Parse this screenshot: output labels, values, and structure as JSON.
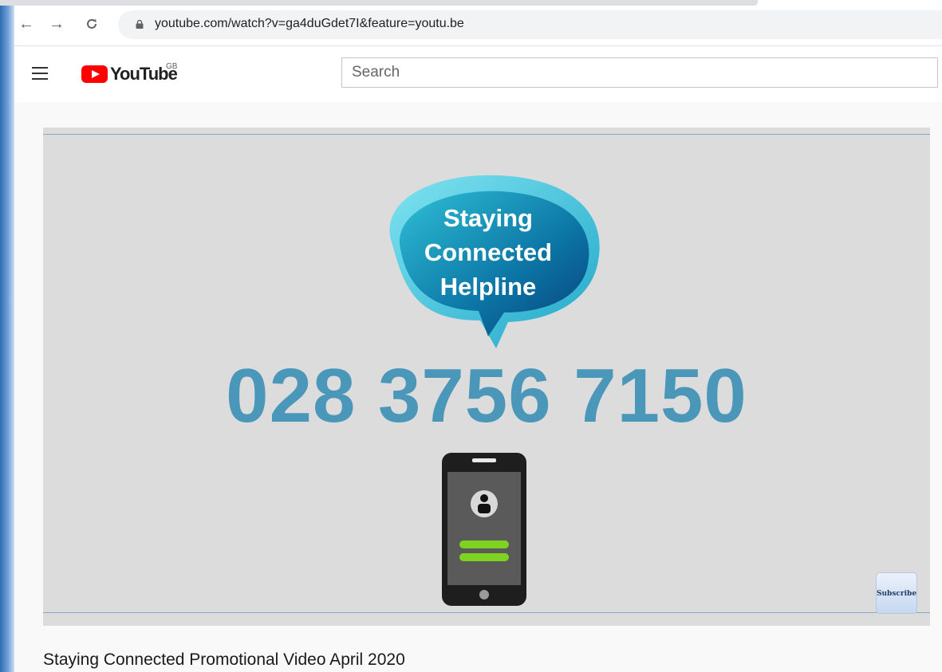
{
  "browser": {
    "url": "youtube.com/watch?v=ga4duGdet7I&feature=youtu.be",
    "back_icon": "arrow-left-icon",
    "forward_icon": "arrow-right-icon",
    "reload_icon": "reload-icon",
    "lock_icon": "lock-icon"
  },
  "youtube": {
    "menu_icon": "hamburger-menu-icon",
    "logo_text": "YouTube",
    "region": "GB",
    "search_placeholder": "Search"
  },
  "video": {
    "bubble_lines": [
      "Staying",
      "Connected",
      "Helpline"
    ],
    "phone_number": "028 3756 7150",
    "subscribe_label": "Subscribe",
    "title": "Staying Connected Promotional Video April 2020"
  },
  "colors": {
    "youtube_red": "#ff0000",
    "phone_number_blue": "#4a97ba",
    "phone_button_green": "#7ed321"
  }
}
